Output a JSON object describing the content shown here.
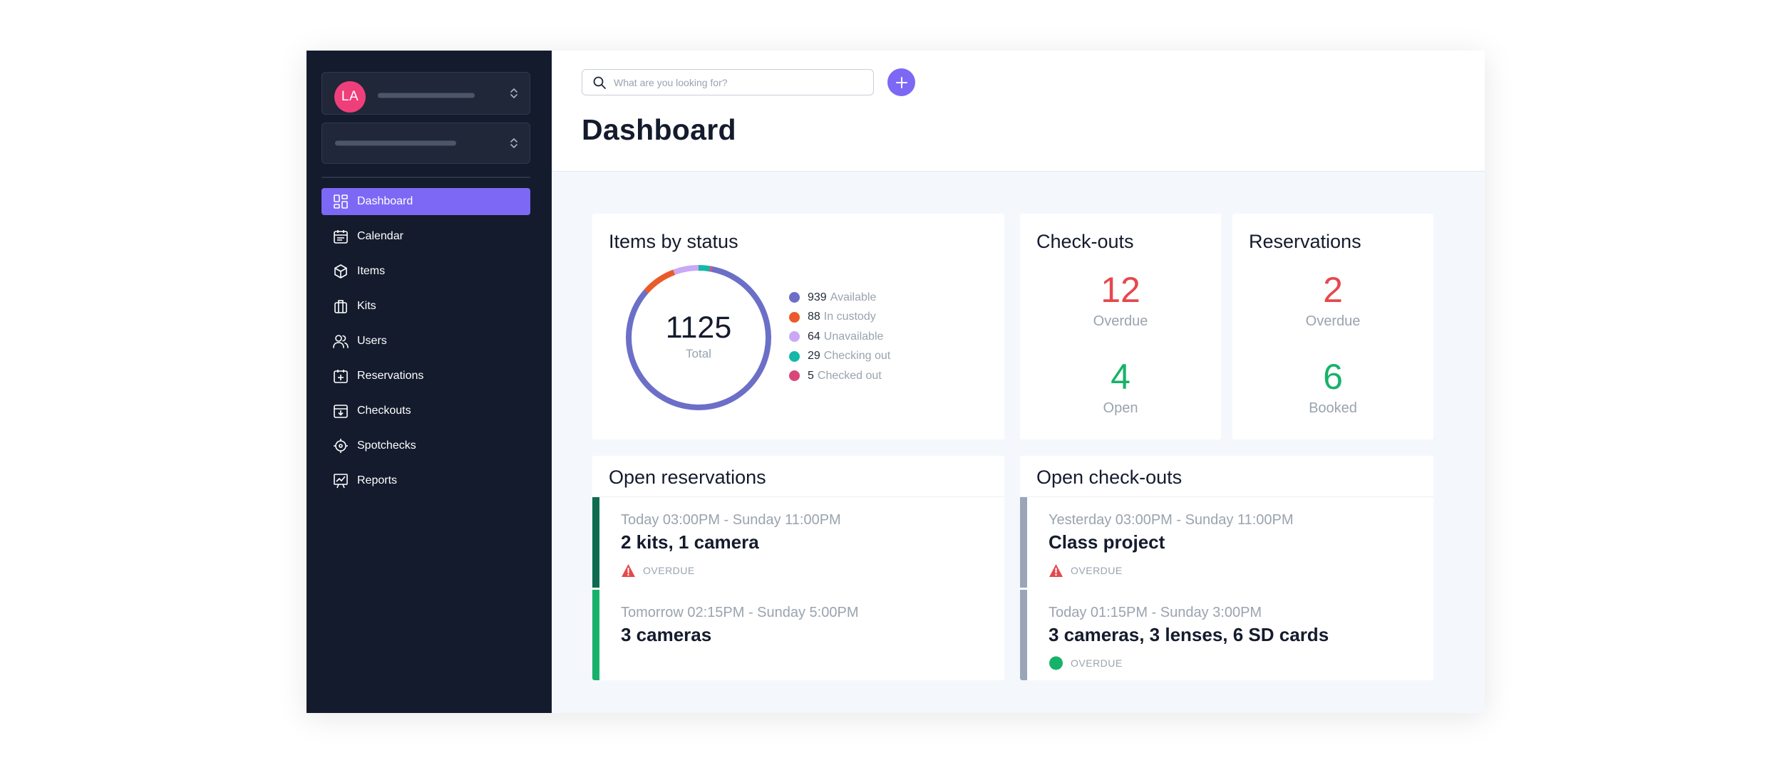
{
  "colors": {
    "sidebar_bg": "#141b2d",
    "accent": "#7c68f5",
    "overdue_red": "#e5484d",
    "ok_green": "#17b26a"
  },
  "sidebar": {
    "avatar_initials": "LA",
    "nav": [
      {
        "label": "Dashboard",
        "icon": "dashboard-grid-icon",
        "active": true
      },
      {
        "label": "Calendar",
        "icon": "calendar-icon"
      },
      {
        "label": "Items",
        "icon": "cube-icon"
      },
      {
        "label": "Kits",
        "icon": "briefcase-icon"
      },
      {
        "label": "Users",
        "icon": "users-icon"
      },
      {
        "label": "Reservations",
        "icon": "calendar-plus-icon"
      },
      {
        "label": "Checkouts",
        "icon": "checkout-tray-icon"
      },
      {
        "label": "Spotchecks",
        "icon": "crosshair-icon"
      },
      {
        "label": "Reports",
        "icon": "chart-presentation-icon"
      }
    ]
  },
  "header": {
    "search_placeholder": "What are you looking for?",
    "title": "Dashboard"
  },
  "items_by_status": {
    "title": "Items by status",
    "total": "1125",
    "total_label": "Total",
    "segments": [
      {
        "count": "939",
        "label": "Available",
        "color": "#6c6fc7"
      },
      {
        "count": "88",
        "label": "In custody",
        "color": "#ea5a2a"
      },
      {
        "count": "64",
        "label": "Unavailable",
        "color": "#c9a8f5"
      },
      {
        "count": "29",
        "label": "Checking out",
        "color": "#14b8a6"
      },
      {
        "count": "5",
        "label": "Checked out",
        "color": "#d9477a"
      }
    ]
  },
  "checkouts": {
    "title": "Check-outs",
    "overdue_count": "12",
    "overdue_label": "Overdue",
    "open_count": "4",
    "open_label": "Open"
  },
  "reservations": {
    "title": "Reservations",
    "overdue_count": "2",
    "overdue_label": "Overdue",
    "booked_count": "6",
    "booked_label": "Booked"
  },
  "open_reservations": {
    "title": "Open reservations",
    "entries": [
      {
        "when": "Today 03:00PM - Sunday 11:00PM",
        "what": "2 kits, 1 camera",
        "flag": "OVERDUE",
        "bar_color": "#0f6b4f"
      },
      {
        "when": "Tomorrow 02:15PM - Sunday 5:00PM",
        "what": "3 cameras",
        "flag": "",
        "bar_color": "#17b26a"
      }
    ]
  },
  "open_checkouts": {
    "title": "Open check-outs",
    "entries": [
      {
        "when": "Yesterday 03:00PM - Sunday 11:00PM",
        "what": "Class project",
        "flag": "OVERDUE",
        "bar_color": "#9aa6b8"
      },
      {
        "when": "Today 01:15PM - Sunday 3:00PM",
        "what": "3 cameras, 3 lenses, 6 SD cards",
        "flag": "OVERDUE",
        "bar_color": "#9aa6b8"
      }
    ]
  }
}
